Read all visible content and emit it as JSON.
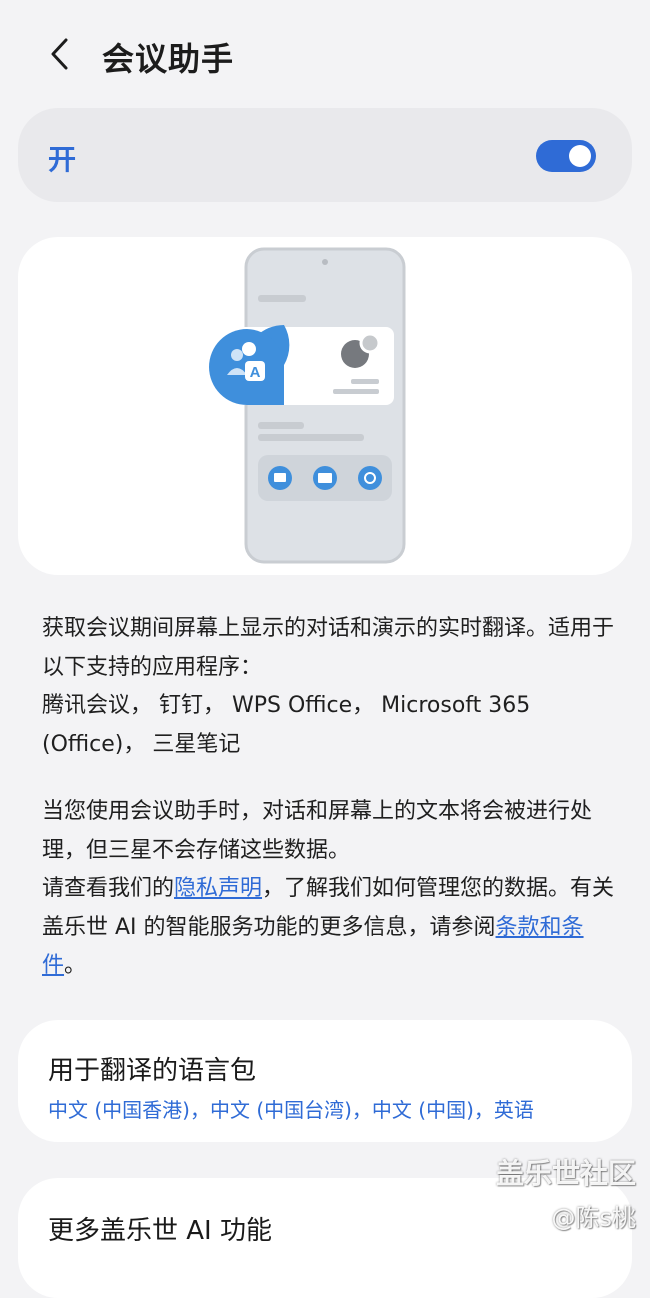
{
  "header": {
    "title": "会议助手",
    "back_icon": "chevron-left-icon"
  },
  "toggle": {
    "label": "开",
    "state": "on",
    "accent": "#2f6bd6"
  },
  "description": {
    "para1": "获取会议期间屏幕上显示的对话和演示的实时翻译。适用于以下支持的应用程序：",
    "para1_apps": "腾讯会议， 钉钉， WPS Office， Microsoft 365 (Office)， 三星笔记",
    "para2": "当您使用会议助手时，对话和屏幕上的文本将会被进行处理，但三星不会存储这些数据。",
    "para3_before": "请查看我们的",
    "privacy_link": "隐私声明",
    "para3_middle": "，了解我们如何管理您的数据。有关盖乐世 AI 的智能服务功能的更多信息，请参阅",
    "terms_link": "条款和条件",
    "para3_after": "。"
  },
  "language_pack": {
    "title": "用于翻译的语言包",
    "subtitle": "中文 (中国香港)，中文 (中国台湾)，中文 (中国)，英语"
  },
  "more_ai": {
    "title": "更多盖乐世 AI 功能"
  },
  "watermark": {
    "line1": "盖乐世社区",
    "line2": "@陈s桃"
  }
}
